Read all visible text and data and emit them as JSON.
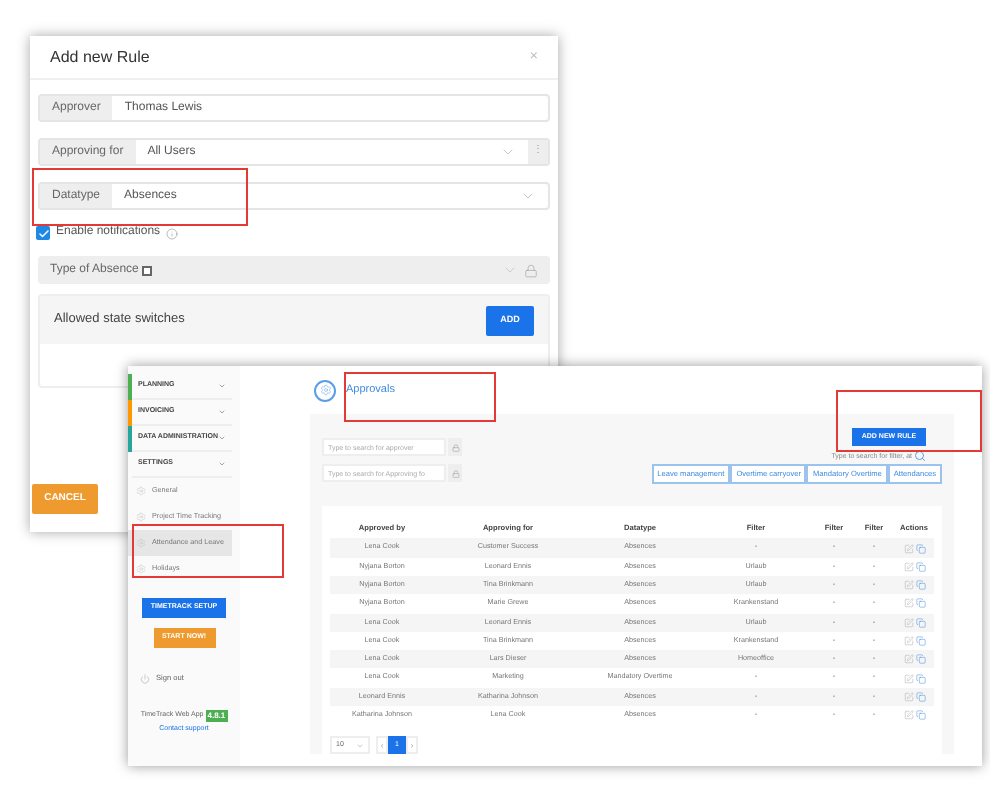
{
  "dialog": {
    "title": "Add new Rule",
    "close": "×",
    "fields": [
      {
        "kind": "input",
        "label": "Approver",
        "value": "Thomas Lewis"
      },
      {
        "kind": "select_extra",
        "label": "Approving for",
        "value": "All Users",
        "extra": "⋮"
      },
      {
        "kind": "select",
        "label": "Datatype",
        "value": "Absences"
      }
    ],
    "notifications": {
      "label": "Enable notifications",
      "checked": true
    },
    "absence_type": {
      "label": "Type of Absence",
      "checked": false,
      "disabled": true
    },
    "state_switches": {
      "title": "Allowed state switches",
      "button": "ADD"
    },
    "cancel": "CANCEL"
  },
  "app": {
    "sidebar": {
      "groups": [
        {
          "label": "PLANNING",
          "color": "#4caf50"
        },
        {
          "label": "INVOICING",
          "color": "#ff9800"
        },
        {
          "label": "DATA ADMINISTRATION",
          "color": "#26a69a"
        },
        {
          "label": "SETTINGS"
        }
      ],
      "settings_items": [
        {
          "label": "General",
          "selected": false
        },
        {
          "label": "Project Time Tracking",
          "selected": false
        },
        {
          "label": "Attendance and Leave",
          "selected": true
        },
        {
          "label": "Holidays",
          "selected": false
        }
      ],
      "setup_button": "TIMETRACK SETUP",
      "start_button": "START NOW!",
      "sign_out": "Sign out",
      "app_name": "TimeTrack Web App",
      "version": "4.8.1",
      "support": "Contact support"
    },
    "header": "Approvals",
    "search_fields": [
      {
        "placeholder": "Type to search for approver"
      },
      {
        "placeholder": "Type to search for Approving fo"
      }
    ],
    "add_rule": "ADD NEW RULE",
    "filter_search": "Type to search for filter, at",
    "filters": [
      {
        "label": "Leave management"
      },
      {
        "label": "Overtime carryover"
      },
      {
        "label": "Mandatory Overtime"
      },
      {
        "label": "Attendances"
      }
    ],
    "table": {
      "columns": [
        "Approved by",
        "Approving for",
        "Datatype",
        "Filter",
        "Filter",
        "Filter",
        "Actions"
      ],
      "rows": [
        [
          "Lena Cook",
          "Customer Success",
          "Absences",
          "-",
          "-",
          "-"
        ],
        [
          "Nyjana Borton",
          "Leonard Ennis",
          "Absences",
          "Urlaub",
          "-",
          "-"
        ],
        [
          "Nyjana Borton",
          "Tina Brinkmann",
          "Absences",
          "Urlaub",
          "-",
          "-"
        ],
        [
          "Nyjana Borton",
          "Marie Grewe",
          "Absences",
          "Krankenstand",
          "-",
          "-"
        ],
        [
          "Lena Cook",
          "Leonard Ennis",
          "Absences",
          "Urlaub",
          "-",
          "-"
        ],
        [
          "Lena Cook",
          "Tina Brinkmann",
          "Absences",
          "Krankenstand",
          "-",
          "-"
        ],
        [
          "Lena Cook",
          "Lars Dieser",
          "Absences",
          "Homeoffice",
          "-",
          "-"
        ],
        [
          "Lena Cook",
          "Marketing",
          "Mandatory Overtime",
          "-",
          "-",
          "-"
        ],
        [
          "Leonard Ennis",
          "Katharina Johnson",
          "Absences",
          "-",
          "-",
          "-"
        ],
        [
          "Katharina Johnson",
          "Lena Cook",
          "Absences",
          "-",
          "-",
          "-"
        ]
      ]
    },
    "pagination": {
      "page_size": "10",
      "prev": "‹",
      "pages": [
        {
          "label": "1",
          "selected": true
        }
      ],
      "next": "›"
    }
  }
}
